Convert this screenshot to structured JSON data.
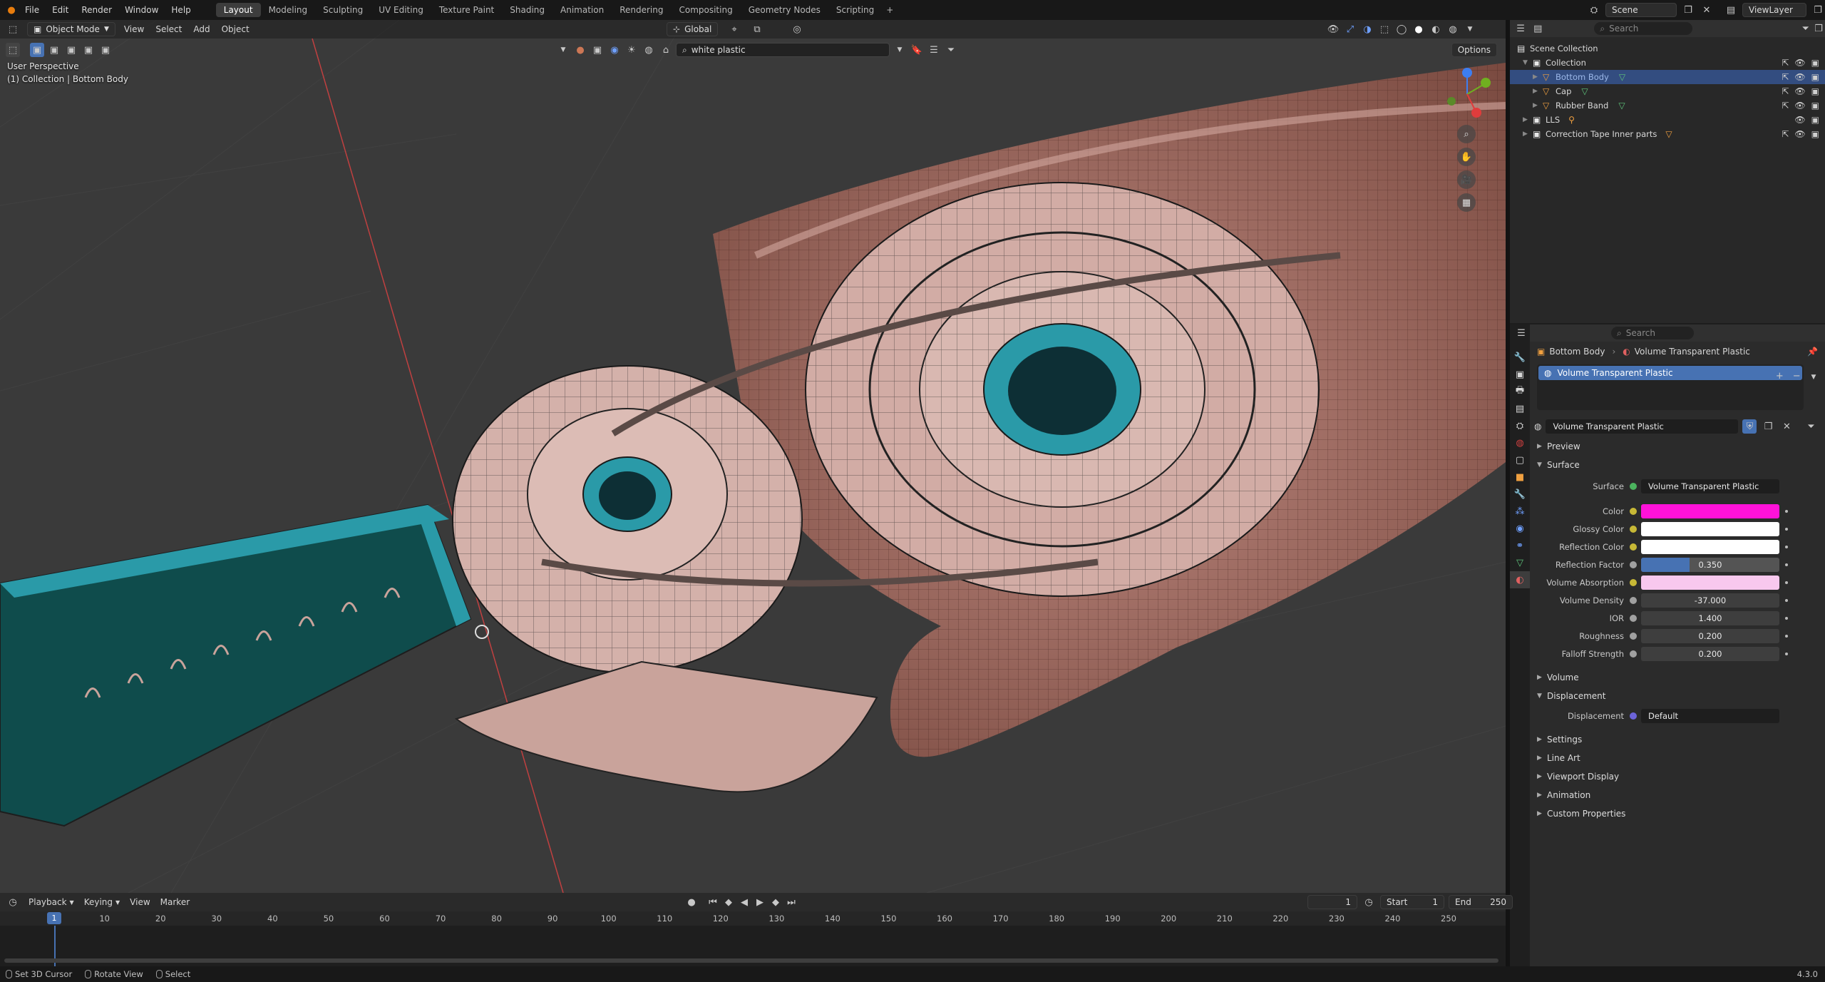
{
  "menu": [
    "File",
    "Edit",
    "Render",
    "Window",
    "Help"
  ],
  "workspaces": [
    {
      "label": "Layout",
      "active": true
    },
    {
      "label": "Modeling"
    },
    {
      "label": "Sculpting"
    },
    {
      "label": "UV Editing"
    },
    {
      "label": "Texture Paint"
    },
    {
      "label": "Shading"
    },
    {
      "label": "Animation"
    },
    {
      "label": "Rendering"
    },
    {
      "label": "Compositing"
    },
    {
      "label": "Geometry Nodes"
    },
    {
      "label": "Scripting"
    }
  ],
  "topright": {
    "scene": "Scene",
    "view_layer": "ViewLayer"
  },
  "viewport": {
    "mode": "Object Mode",
    "menus": [
      "View",
      "Select",
      "Add",
      "Object"
    ],
    "transform": "Global",
    "search_value": "white plastic",
    "options": "Options",
    "info_line1": "User Perspective",
    "info_line2": "(1) Collection | Bottom Body"
  },
  "outliner": {
    "search_placeholder": "Search",
    "rows": [
      {
        "label": "Scene Collection",
        "indent": 0,
        "type": "scene"
      },
      {
        "label": "Collection",
        "indent": 1,
        "type": "collection"
      },
      {
        "label": "Bottom Body",
        "indent": 2,
        "type": "object",
        "selected": true
      },
      {
        "label": "Cap",
        "indent": 2,
        "type": "object"
      },
      {
        "label": "Rubber Band",
        "indent": 2,
        "type": "object"
      },
      {
        "label": "LLS",
        "indent": 1,
        "type": "collection"
      },
      {
        "label": "Correction Tape Inner parts",
        "indent": 1,
        "type": "collection"
      }
    ]
  },
  "properties": {
    "search_placeholder": "Search",
    "breadcrumb_object": "Bottom Body",
    "breadcrumb_material": "Volume Transparent Plastic",
    "slot": "Volume Transparent Plastic",
    "material_name": "Volume Transparent Plastic",
    "panels": {
      "preview": "Preview",
      "surface": "Surface",
      "volume": "Volume",
      "displacement": "Displacement",
      "settings": "Settings",
      "line_art": "Line Art",
      "viewport_display": "Viewport Display",
      "animation": "Animation",
      "custom_properties": "Custom Properties"
    },
    "surface_shader_label": "Surface",
    "surface_shader": "Volume Transparent Plastic",
    "inputs": [
      {
        "label": "Color",
        "kind": "color",
        "color": "#ff12d9"
      },
      {
        "label": "Glossy Color",
        "kind": "color",
        "color": "#ffffff"
      },
      {
        "label": "Reflection Color",
        "kind": "color",
        "color": "#ffffff"
      },
      {
        "label": "Reflection Factor",
        "kind": "slider",
        "value": "0.350",
        "fraction": 0.35
      },
      {
        "label": "Volume Absorption",
        "kind": "color",
        "color": "#f8c8ee"
      },
      {
        "label": "Volume Density",
        "kind": "number",
        "value": "-37.000"
      },
      {
        "label": "IOR",
        "kind": "number",
        "value": "1.400"
      },
      {
        "label": "Roughness",
        "kind": "number",
        "value": "0.200"
      },
      {
        "label": "Falloff Strength",
        "kind": "number",
        "value": "0.200"
      }
    ],
    "displacement_label": "Displacement",
    "displacement_value": "Default"
  },
  "timeline": {
    "menus": [
      "Playback",
      "Keying",
      "View",
      "Marker"
    ],
    "current_frame": "1",
    "start_label": "Start",
    "start": "1",
    "end_label": "End",
    "end": "250",
    "ticks": [
      "1",
      "10",
      "20",
      "30",
      "40",
      "50",
      "60",
      "70",
      "80",
      "90",
      "100",
      "110",
      "120",
      "130",
      "140",
      "150",
      "160",
      "170",
      "180",
      "190",
      "200",
      "210",
      "220",
      "230",
      "240",
      "250"
    ]
  },
  "status": {
    "items": [
      "Set 3D Cursor",
      "Rotate View",
      "Select"
    ],
    "version": "4.3.0"
  }
}
